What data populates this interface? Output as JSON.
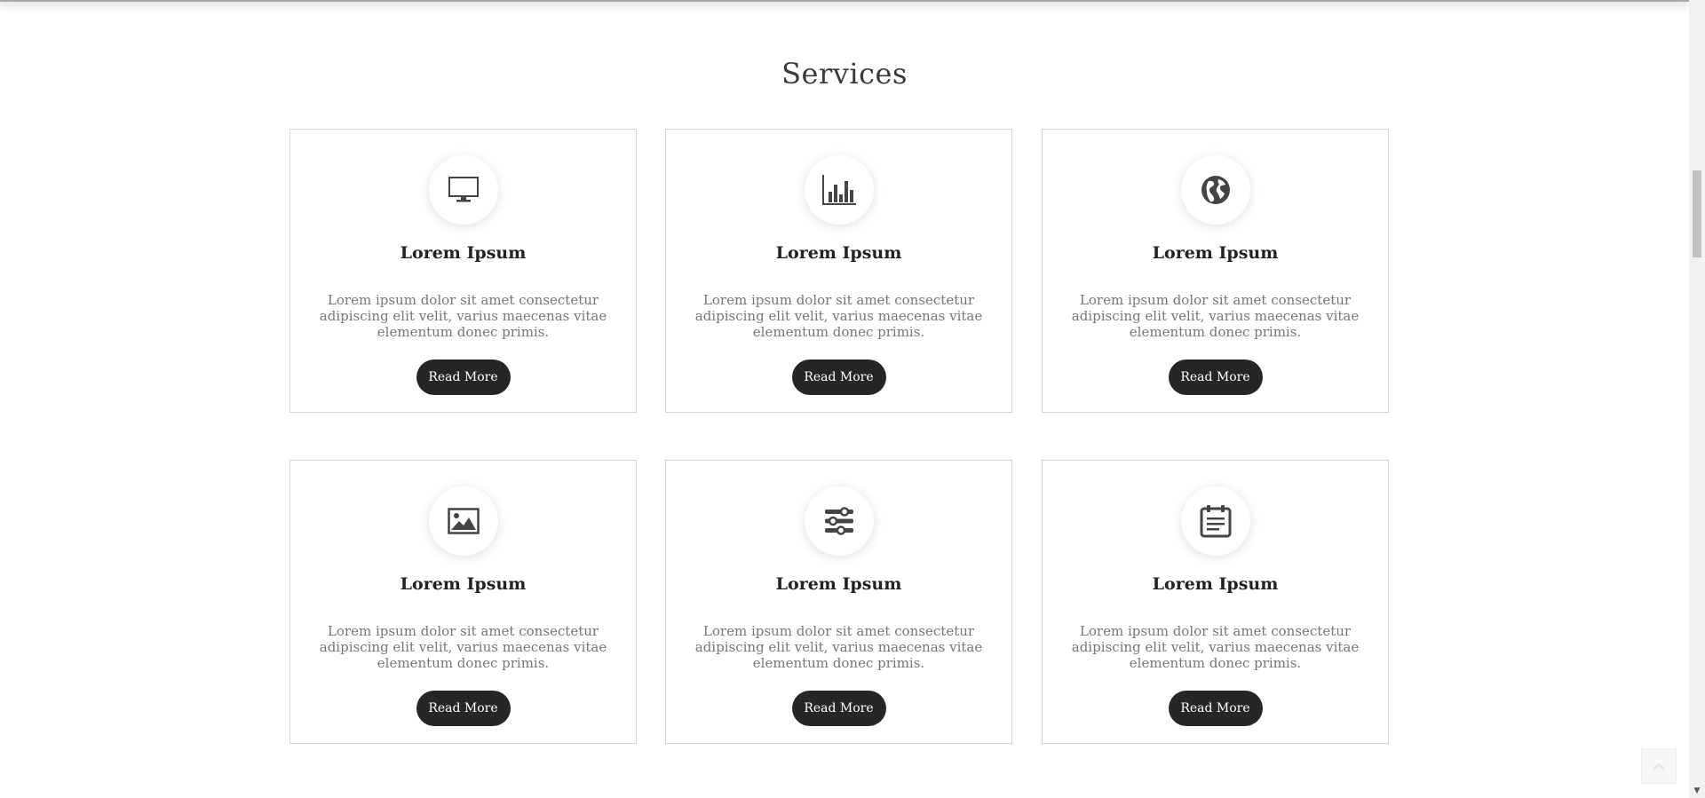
{
  "section": {
    "title": "Services"
  },
  "cards": [
    {
      "icon": "monitor-icon",
      "title": "Lorem Ipsum",
      "text": "Lorem ipsum dolor sit amet consectetur adipiscing elit velit, varius maecenas vitae elementum donec primis.",
      "button": "Read More"
    },
    {
      "icon": "bar-chart-icon",
      "title": "Lorem Ipsum",
      "text": "Lorem ipsum dolor sit amet consectetur adipiscing elit velit, varius maecenas vitae elementum donec primis.",
      "button": "Read More"
    },
    {
      "icon": "globe-icon",
      "title": "Lorem Ipsum",
      "text": "Lorem ipsum dolor sit amet consectetur adipiscing elit velit, varius maecenas vitae elementum donec primis.",
      "button": "Read More"
    },
    {
      "icon": "image-icon",
      "title": "Lorem Ipsum",
      "text": "Lorem ipsum dolor sit amet consectetur adipiscing elit velit, varius maecenas vitae elementum donec primis.",
      "button": "Read More"
    },
    {
      "icon": "sliders-icon",
      "title": "Lorem Ipsum",
      "text": "Lorem ipsum dolor sit amet consectetur adipiscing elit velit, varius maecenas vitae elementum donec primis.",
      "button": "Read More"
    },
    {
      "icon": "calendar-notes-icon",
      "title": "Lorem Ipsum",
      "text": "Lorem ipsum dolor sit amet consectetur adipiscing elit velit, varius maecenas vitae elementum donec primis.",
      "button": "Read More"
    }
  ],
  "colors": {
    "button_bg": "#262626",
    "card_border": "#d5d5d5",
    "body_text": "#777777",
    "icon": "#444444"
  }
}
